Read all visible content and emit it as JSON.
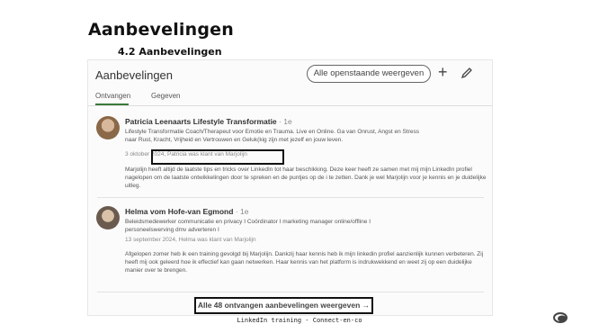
{
  "slide": {
    "title": "Aanbevelingen",
    "subtitle": "4.2 Aanbevelingen",
    "footer": "LinkedIn training - Connect-en-co"
  },
  "panel": {
    "title": "Aanbevelingen",
    "pending_button": "Alle openstaande weergeven",
    "tabs": [
      "Ontvangen",
      "Gegeven"
    ],
    "active_tab": "Ontvangen"
  },
  "recommendations": [
    {
      "name": "Patricia Leenaarts Lifestyle Transformatie",
      "degree": "· 1e",
      "headline_1": "Lifestyle Transformatie Coach/Therapeut voor Emotie en Trauma. Live en Online. Ga van Onrust, Angst en Stress",
      "headline_2": "naar Rust, Kracht, Vrijheid en Vertrouwen en Geluk(kig zijn met jezelf en jouw leven.",
      "meta": "3 oktober 2024, Patricia was klant van Marjolijn",
      "text": "Marjolijn heeft altijd de laatste tips en tricks over LinkedIn tot haar beschikking. Deze keer heeft ze samen met mij mijn LinkedIn profiel nagelopen om de laatste ontwikkelingen door te spreken en de puntjes op de i te zetten. Dank je wel Marjolijn voor je kennis en je duidelijke uitleg."
    },
    {
      "name": "Helma vom Hofe-van Egmond",
      "degree": "· 1e",
      "headline_1": "Beleidsmedewerker communicatie en privacy I Coördinator I marketing manager online/offline I",
      "headline_2": "personeelswerving dmv adverteren I",
      "meta": "13 september 2024, Helma was klant van Marjolijn",
      "text": "Afgelopen zomer heb ik een training gevolgd bij Marjolijn. Dankzij haar kennis heb ik mijn linkedin profiel aanzienlijk kunnen verbeteren. Zij heeft mij ook geleerd hoe ik effectief kan gaan netwerken. Haar kennis van het platform is indrukwekkend en weet zij op een duidelijke manier over te brengen."
    }
  ],
  "show_all_link": "Alle 48 ontvangen aanbevelingen weergeven →",
  "icons": [
    "plus-icon",
    "pencil-icon",
    "logo-icon"
  ],
  "colors": {
    "tab_underline": "#3a7a3a",
    "highlight_border": "#111111"
  }
}
